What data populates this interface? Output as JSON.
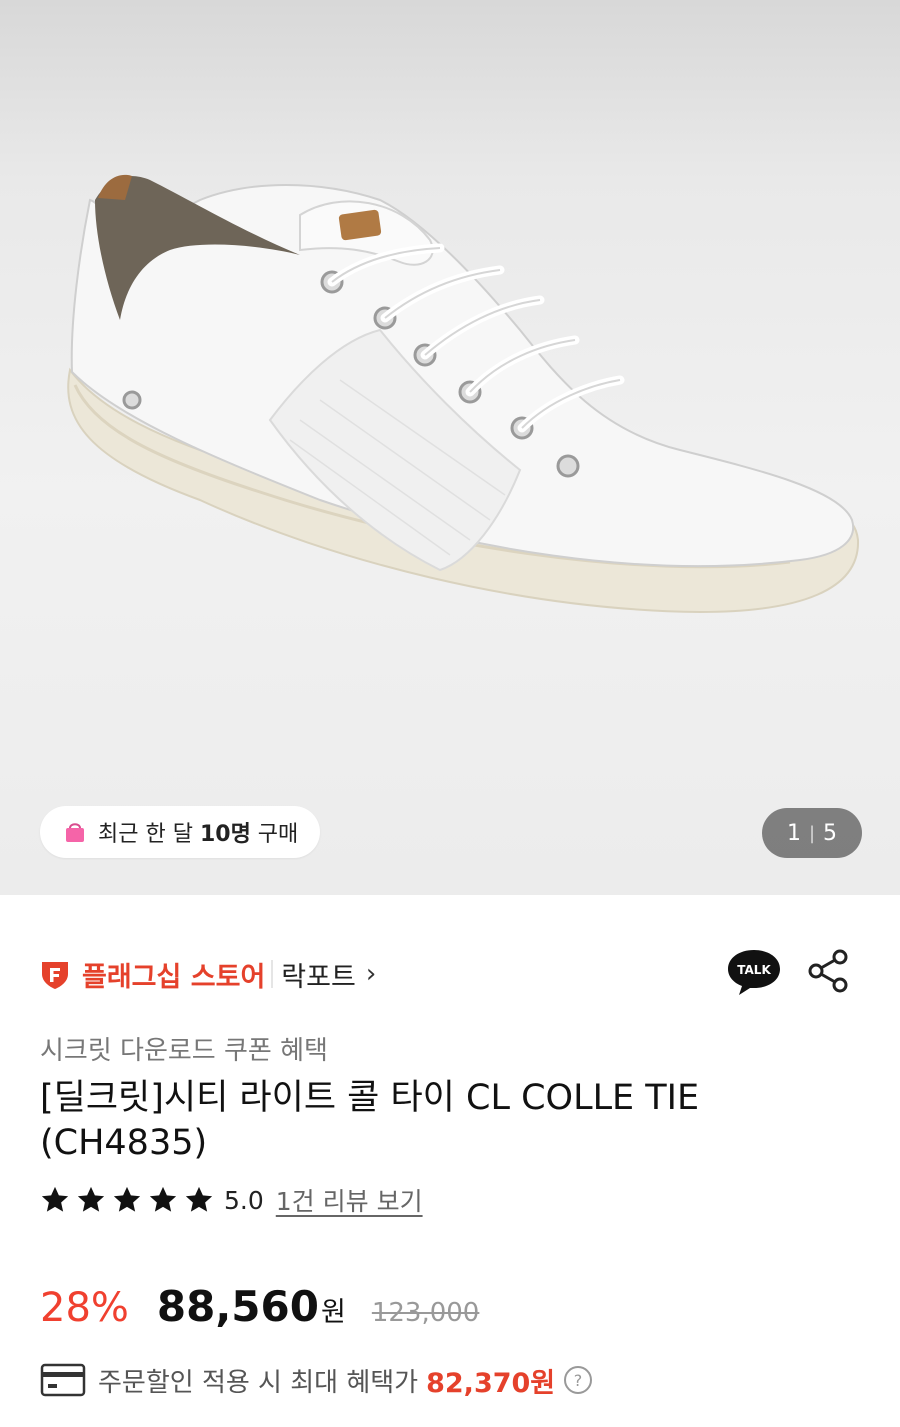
{
  "gallery": {
    "badge": {
      "prefix": "최근 한 달 ",
      "count": "10명",
      "suffix": " 구매"
    },
    "pager": {
      "current": "1",
      "separator": "|",
      "total": "5"
    }
  },
  "store": {
    "type_label": "플래그십 스토어",
    "name": "락포트",
    "chevron": "›"
  },
  "product": {
    "promo": "시크릿 다운로드 쿠폰 혜택",
    "title_line1": "[딜크릿]시티 라이트 콜 타이 CL COLLE TIE",
    "title_line2": "(CH4835)",
    "rating": {
      "value": "5.0",
      "stars": 5,
      "review_link": "1건 리뷰 보기"
    },
    "price": {
      "discount": "28%",
      "sale_price": "88,560",
      "currency": "원",
      "original_price": "123,000"
    },
    "benefit": {
      "text": "주문할인 적용 시 최대 혜택가",
      "price": "82,370원"
    }
  },
  "colors": {
    "accent": "#e5412b",
    "discount": "#f0402f",
    "badge_bag": "#f564a8"
  },
  "icons": [
    "shopping-bag-icon",
    "store-logo-icon",
    "talk-icon",
    "share-icon",
    "star-icon",
    "card-icon",
    "help-icon"
  ]
}
